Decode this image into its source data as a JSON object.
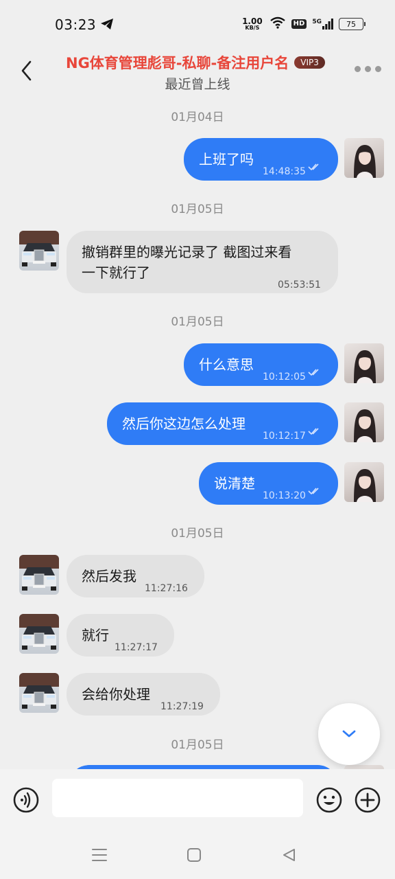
{
  "status_bar": {
    "time": "03:23",
    "net_speed_value": "1.00",
    "net_speed_unit": "KB/S",
    "hd_label": "HD",
    "network_label": "5G",
    "battery": "75"
  },
  "header": {
    "contact_name": "NG体育管理彪哥-私聊-备注用户名",
    "vip_badge": "VIP3",
    "status": "最近曾上线"
  },
  "messages": [
    {
      "type": "date",
      "text": "01月04日"
    },
    {
      "type": "message",
      "direction": "out",
      "text": "上班了吗",
      "time": "14:48:35",
      "read": true
    },
    {
      "type": "date",
      "text": "01月05日"
    },
    {
      "type": "message",
      "direction": "in",
      "lines": [
        "撤销群里的曝光记录了  截图过来看",
        "一下就行了"
      ],
      "time": "05:53:51"
    },
    {
      "type": "date",
      "text": "01月05日"
    },
    {
      "type": "message",
      "direction": "out",
      "text": "什么意思",
      "time": "10:12:05",
      "read": true
    },
    {
      "type": "message",
      "direction": "out",
      "text": "然后你这边怎么处理",
      "time": "10:12:17",
      "read": true
    },
    {
      "type": "message",
      "direction": "out",
      "text": "说清楚",
      "time": "10:13:20",
      "read": true
    },
    {
      "type": "date",
      "text": "01月05日"
    },
    {
      "type": "message",
      "direction": "in",
      "text": "然后发我",
      "time": "11:27:16"
    },
    {
      "type": "message",
      "direction": "in",
      "text": "就行",
      "time": "11:27:17"
    },
    {
      "type": "message",
      "direction": "in",
      "text": "会给你处理",
      "time": "11:27:19"
    },
    {
      "type": "date",
      "text": "01月05日"
    }
  ],
  "input": {
    "value": "",
    "placeholder": ""
  },
  "colors": {
    "accent": "#2f7cf6",
    "name_red": "#e8463a",
    "incoming_bubble": "#e2e2e2",
    "background": "#efefef"
  }
}
